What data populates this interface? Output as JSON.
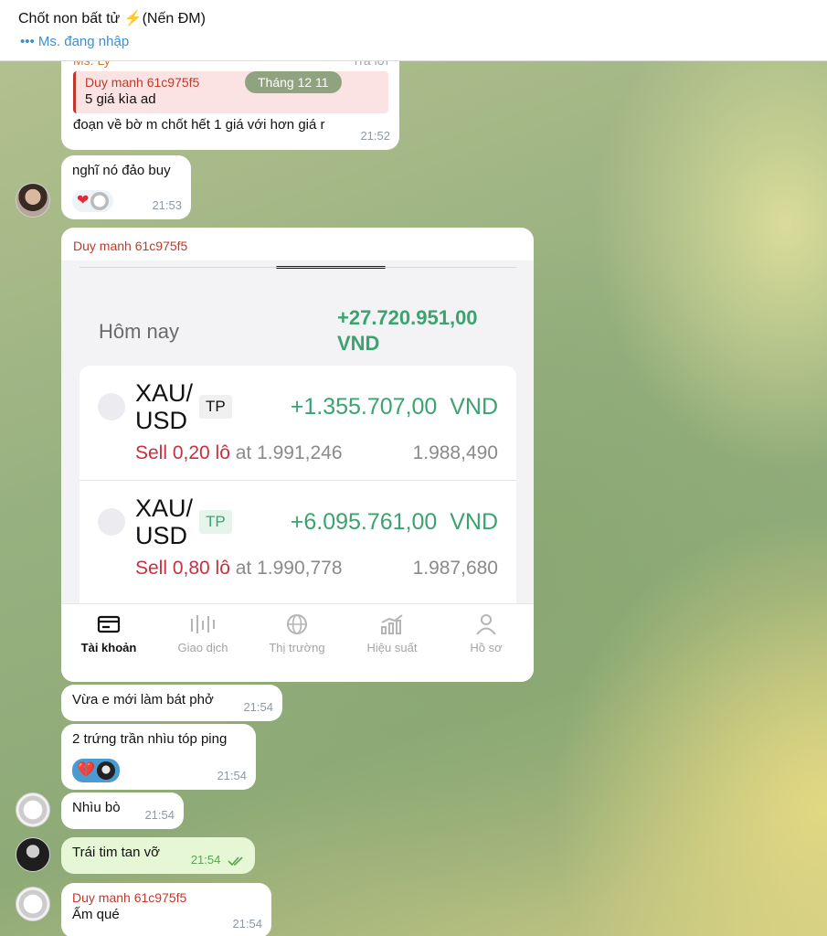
{
  "header": {
    "title": "Chốt non bất tử ⚡(Nến ĐM)",
    "status": "••• Ms. đang nhập"
  },
  "date_pill": "Tháng 12 11",
  "messages": {
    "m1": {
      "sender": "Ms. Ly",
      "reply_action": "Trả lời",
      "reply_name": "Duy manh 61c975f5",
      "reply_text": "5 giá kìa ad",
      "text": "đoạn về bờ m chốt hết 1 giá với hơn giá r",
      "time": "21:52"
    },
    "m2": {
      "text": "nghĩ nó đảo buy",
      "time": "21:53"
    },
    "m3": {
      "sender": "Duy manh 61c975f5"
    },
    "m4": {
      "text": "Vừa e mới làm bát phở",
      "time": "21:54"
    },
    "m5": {
      "text": "2 trứng trần nhìu tóp ping",
      "time": "21:54"
    },
    "m6": {
      "text": "Nhìu bò",
      "time": "21:54"
    },
    "m7": {
      "text": "Trái tim tan vỡ",
      "time": "21:54"
    },
    "m8": {
      "sender": "Duy manh 61c975f5",
      "text": "Ấm qué",
      "time": "21:54"
    }
  },
  "screenshot": {
    "today_label": "Hôm nay",
    "today_value_line1": "+27.720.951,00",
    "today_value_line2": "VND",
    "trades": [
      {
        "pair1": "XAU/",
        "pair2": "USD",
        "tag": "TP",
        "pl": "+1.355.707,00  VND",
        "sell": "Sell 0,20 lô",
        "at": " at 1.991,246",
        "current": "1.988,490"
      },
      {
        "pair1": "XAU/",
        "pair2": "USD",
        "tag": "TP",
        "pl": "+6.095.761,00  VND",
        "sell": "Sell 0,80 lô",
        "at": " at 1.990,778",
        "current": "1.987,680"
      }
    ],
    "nav": [
      "Tài khoản",
      "Giao dịch",
      "Thị trường",
      "Hiệu suất",
      "Hồ sơ"
    ]
  },
  "colors": {
    "sender_red": "#c0392b",
    "profit_green": "#3aa370",
    "sell_red": "#c8303f",
    "accent_blue": "#3a8fd4"
  }
}
